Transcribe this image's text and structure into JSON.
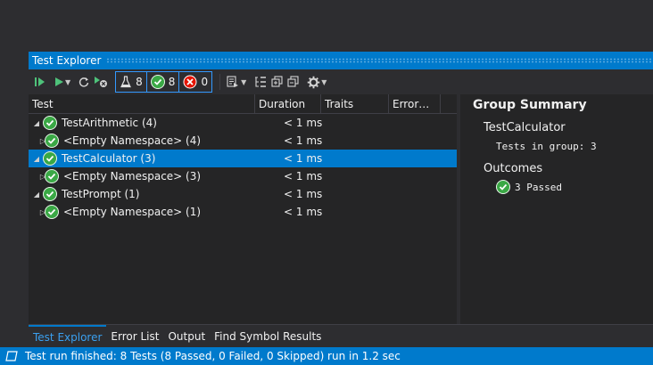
{
  "window": {
    "title": "Test Explorer"
  },
  "toolbar": {
    "items": [
      {
        "name": "run-all-icon",
        "glyph": "▶"
      },
      {
        "name": "run-icon",
        "glyph": "▶"
      },
      {
        "name": "repeat-last-run-icon",
        "glyph": "↻"
      },
      {
        "name": "run-failed-icon",
        "glyph": "⊗"
      }
    ],
    "filters": {
      "total": "8",
      "passed": "8",
      "failed": "0"
    }
  },
  "columns": [
    "Test",
    "Duration",
    "Traits",
    "Error…"
  ],
  "tests": [
    {
      "name": "TestArithmetic  (4)",
      "duration": "< 1 ms",
      "level": 0,
      "expanded": true,
      "selected": false
    },
    {
      "name": "<Empty Namespace>  (4)",
      "duration": "< 1 ms",
      "level": 1,
      "expanded": false,
      "selected": false
    },
    {
      "name": "TestCalculator  (3)",
      "duration": "< 1 ms",
      "level": 0,
      "expanded": true,
      "selected": true
    },
    {
      "name": "<Empty Namespace>  (3)",
      "duration": "< 1 ms",
      "level": 1,
      "expanded": false,
      "selected": false
    },
    {
      "name": "TestPrompt  (1)",
      "duration": "< 1 ms",
      "level": 0,
      "expanded": true,
      "selected": false
    },
    {
      "name": "<Empty Namespace>  (1)",
      "duration": "< 1 ms",
      "level": 1,
      "expanded": false,
      "selected": false
    }
  ],
  "summary": {
    "title": "Group Summary",
    "group": "TestCalculator",
    "tests_in_group": "Tests in group: 3",
    "outcomes_label": "Outcomes",
    "passed": "3 Passed"
  },
  "bottom_tabs": [
    {
      "label": "Test Explorer",
      "active": true
    },
    {
      "label": "Error List",
      "active": false
    },
    {
      "label": "Output",
      "active": false
    },
    {
      "label": "Find Symbol Results",
      "active": false
    }
  ],
  "status": {
    "text": "Test run finished: 8 Tests (8 Passed, 0 Failed, 0 Skipped) run in 1.2 sec"
  },
  "colors": {
    "accent": "#007acc",
    "passed": "#3aa845",
    "failed": "#e51400",
    "background": "#252526"
  }
}
